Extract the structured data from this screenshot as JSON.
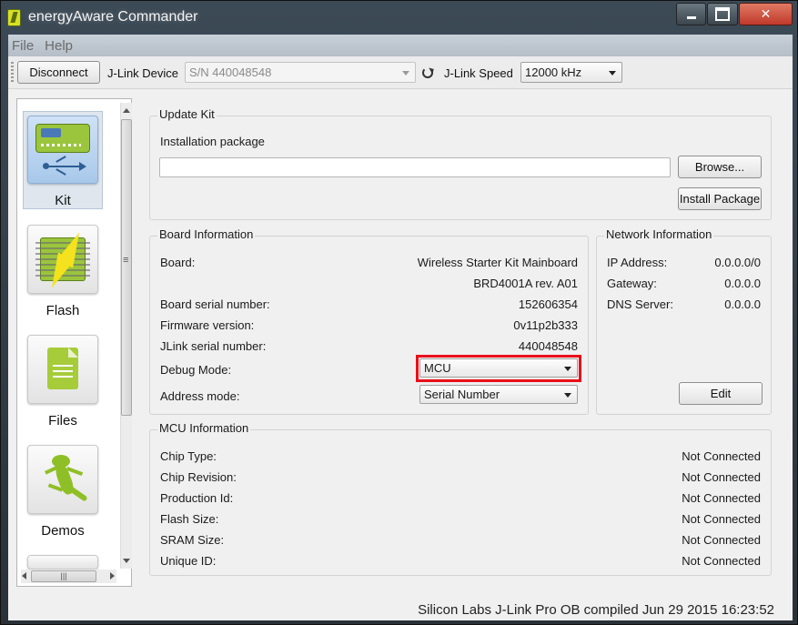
{
  "window": {
    "title": "energyAware Commander"
  },
  "menu": {
    "items": [
      "File",
      "Help"
    ]
  },
  "toolbar": {
    "disconnect_label": "Disconnect",
    "jlink_device_label": "J-Link Device",
    "jlink_device_value": "S/N 440048548",
    "jlink_speed_label": "J-Link Speed",
    "jlink_speed_value": "12000 kHz"
  },
  "sidebar": {
    "items": [
      {
        "label": "Kit",
        "icon": "kit-board-usb-icon",
        "active": true
      },
      {
        "label": "Flash",
        "icon": "flash-chip-icon",
        "active": false
      },
      {
        "label": "Files",
        "icon": "file-icon",
        "active": false
      },
      {
        "label": "Demos",
        "icon": "gecko-icon",
        "active": false
      }
    ]
  },
  "update_kit": {
    "title": "Update Kit",
    "package_label": "Installation package",
    "package_value": "",
    "browse_label": "Browse...",
    "install_label": "Install Package"
  },
  "board_info": {
    "title": "Board Information",
    "board_label": "Board:",
    "board_value_1": "Wireless Starter Kit Mainboard",
    "board_value_2": "BRD4001A rev. A01",
    "serial_label": "Board serial number:",
    "serial_value": "152606354",
    "firmware_label": "Firmware version:",
    "firmware_value": "0v11p2b333",
    "jlink_serial_label": "JLink serial number:",
    "jlink_serial_value": "440048548",
    "debug_mode_label": "Debug Mode:",
    "debug_mode_value": "MCU",
    "address_mode_label": "Address mode:",
    "address_mode_value": "Serial Number"
  },
  "network_info": {
    "title": "Network Information",
    "ip_label": "IP Address:",
    "ip_value": "0.0.0.0/0",
    "gateway_label": "Gateway:",
    "gateway_value": "0.0.0.0",
    "dns_label": "DNS Server:",
    "dns_value": "0.0.0.0",
    "edit_label": "Edit"
  },
  "mcu_info": {
    "title": "MCU Information",
    "rows": [
      {
        "label": "Chip Type:",
        "value": "Not Connected"
      },
      {
        "label": "Chip Revision:",
        "value": "Not Connected"
      },
      {
        "label": "Production Id:",
        "value": "Not Connected"
      },
      {
        "label": "Flash Size:",
        "value": "Not Connected"
      },
      {
        "label": "SRAM Size:",
        "value": "Not Connected"
      },
      {
        "label": "Unique ID:",
        "value": "Not Connected"
      }
    ]
  },
  "status": {
    "text": "Silicon Labs J-Link Pro OB compiled Jun 29 2015 16:23:52"
  },
  "colors": {
    "highlight": "#e8101a",
    "active_nav": "#a8c8ea"
  }
}
